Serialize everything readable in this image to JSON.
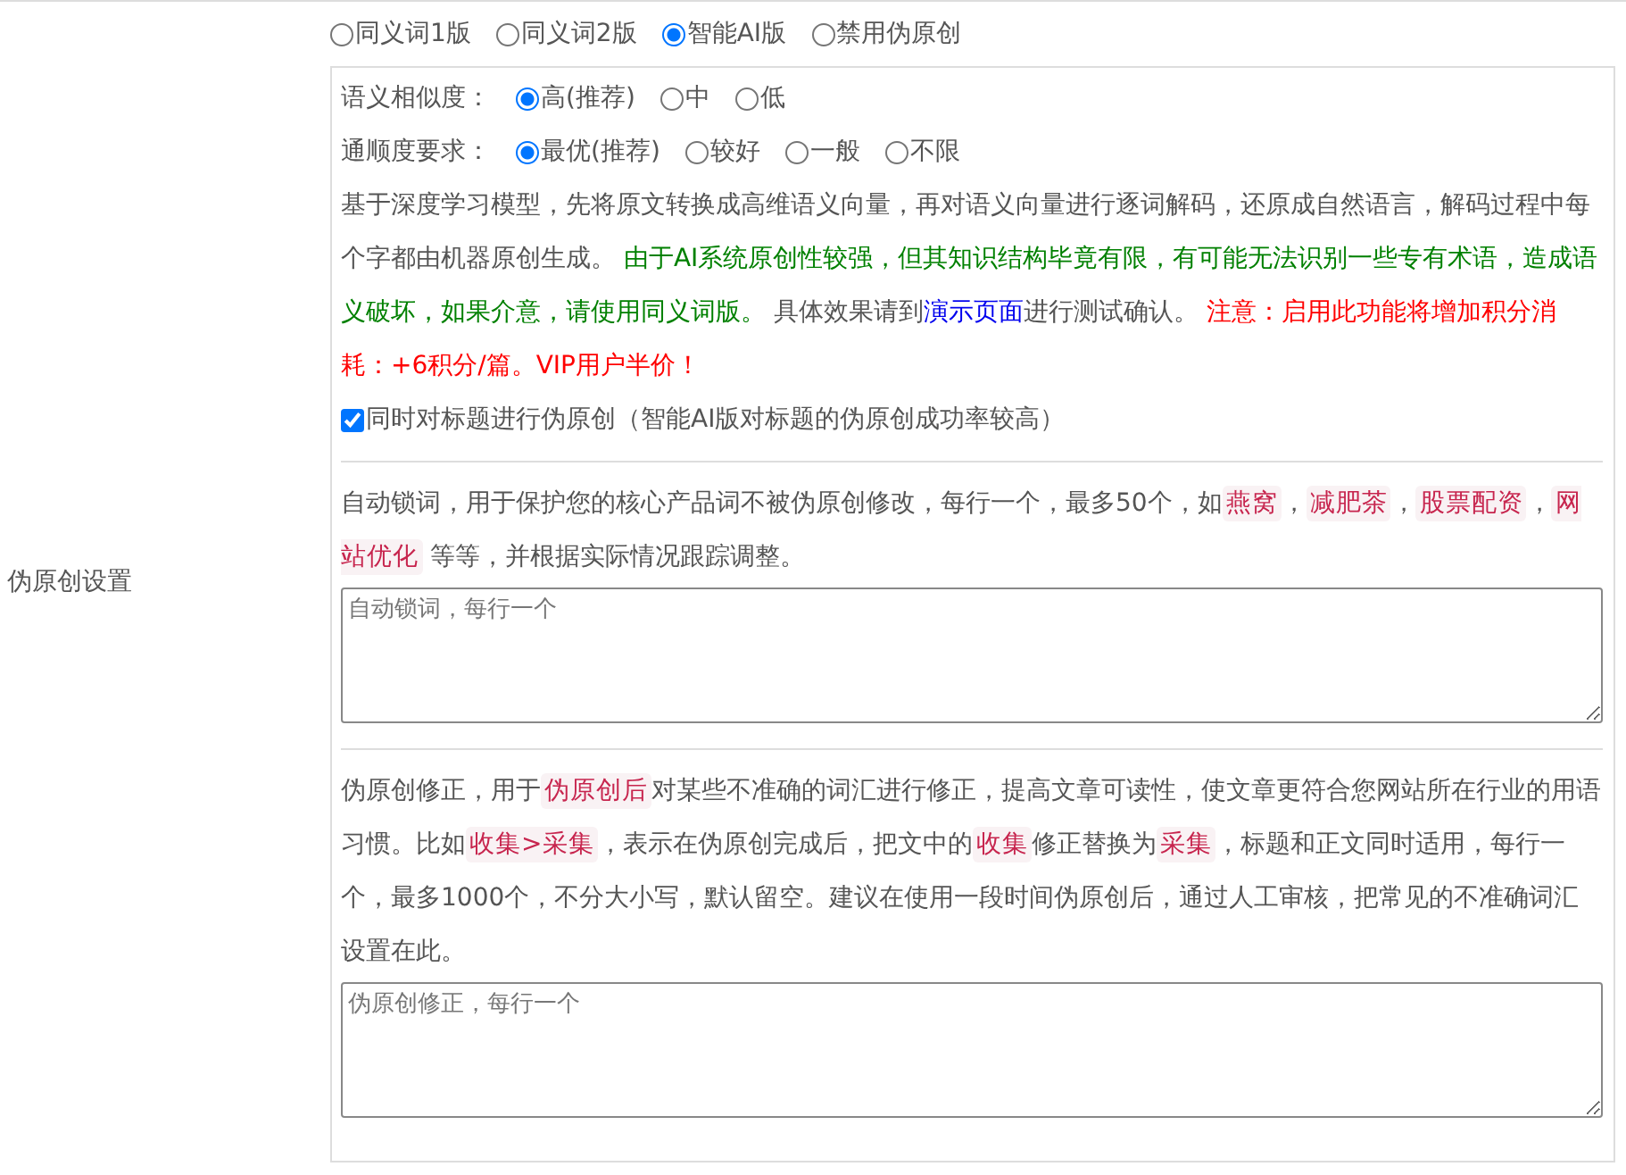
{
  "sidebar_label": "伪原创设置",
  "modes": [
    {
      "label": "同义词1版",
      "selected": false
    },
    {
      "label": "同义词2版",
      "selected": false
    },
    {
      "label": "智能AI版",
      "selected": true
    },
    {
      "label": "禁用伪原创",
      "selected": false
    }
  ],
  "similarity": {
    "label": "语义相似度：",
    "options": [
      {
        "label": "高(推荐)",
        "selected": true
      },
      {
        "label": "中",
        "selected": false
      },
      {
        "label": "低",
        "selected": false
      }
    ]
  },
  "fluency": {
    "label": "通顺度要求：",
    "options": [
      {
        "label": "最优(推荐)",
        "selected": true
      },
      {
        "label": "较好",
        "selected": false
      },
      {
        "label": "一般",
        "selected": false
      },
      {
        "label": "不限",
        "selected": false
      }
    ]
  },
  "ai_note": [
    {
      "kind": "text",
      "text": "基于深度学习模型，先将原文转换成高维语义向量，再对语义向量进行逐词解码，还原成自然语言，解码过程中每个字都由机器原创生成。 "
    },
    {
      "kind": "note",
      "text": "由于AI系统原创性较强，但其知识结构毕竟有限，有可能无法识别一些专有术语，造成语义破坏，如果介意，请使用同义词版。"
    },
    {
      "kind": "text",
      "text": " 具体效果请到"
    },
    {
      "kind": "link",
      "text": "演示页面"
    },
    {
      "kind": "text",
      "text": "进行测试确认。 "
    },
    {
      "kind": "warning",
      "text": "注意：启用此功能将增加积分消耗：+6积分/篇。VIP用户半价！"
    }
  ],
  "title_option": {
    "label": "同时对标题进行伪原创（智能AI版对标题的伪原创成功率较高）",
    "checked": true
  },
  "lock_words": {
    "description": [
      {
        "kind": "text",
        "text": "自动锁词，用于保护您的核心产品词不被伪原创修改，每行一个，最多50个，如"
      },
      {
        "kind": "code",
        "text": "燕窝"
      },
      {
        "kind": "text",
        "text": "，"
      },
      {
        "kind": "code",
        "text": "减肥茶"
      },
      {
        "kind": "text",
        "text": "，"
      },
      {
        "kind": "code",
        "text": "股票配资"
      },
      {
        "kind": "text",
        "text": "，"
      },
      {
        "kind": "code",
        "text": "网站优化"
      },
      {
        "kind": "text",
        "text": " 等等，并根据实际情况跟踪调整。"
      }
    ],
    "placeholder": "自动锁词，每行一个"
  },
  "correction": {
    "description": [
      {
        "kind": "text",
        "text": "伪原创修正，用于"
      },
      {
        "kind": "code",
        "text": "伪原创后"
      },
      {
        "kind": "text",
        "text": "对某些不准确的词汇进行修正，提高文章可读性，使文章更符合您网站所在行业的用语习惯。比如"
      },
      {
        "kind": "code",
        "text": "收集>采集"
      },
      {
        "kind": "text",
        "text": "，表示在伪原创完成后，把文中的"
      },
      {
        "kind": "code",
        "text": "收集"
      },
      {
        "kind": "text",
        "text": "修正替换为"
      },
      {
        "kind": "code",
        "text": "采集"
      },
      {
        "kind": "text",
        "text": "，标题和正文同时适用，每行一个，最多1000个，不分大小写，默认留空。建议在使用一段时间伪原创后，通过人工审核，把常见的不准确词汇设置在此。"
      }
    ],
    "placeholder": "伪原创修正，每行一个"
  }
}
